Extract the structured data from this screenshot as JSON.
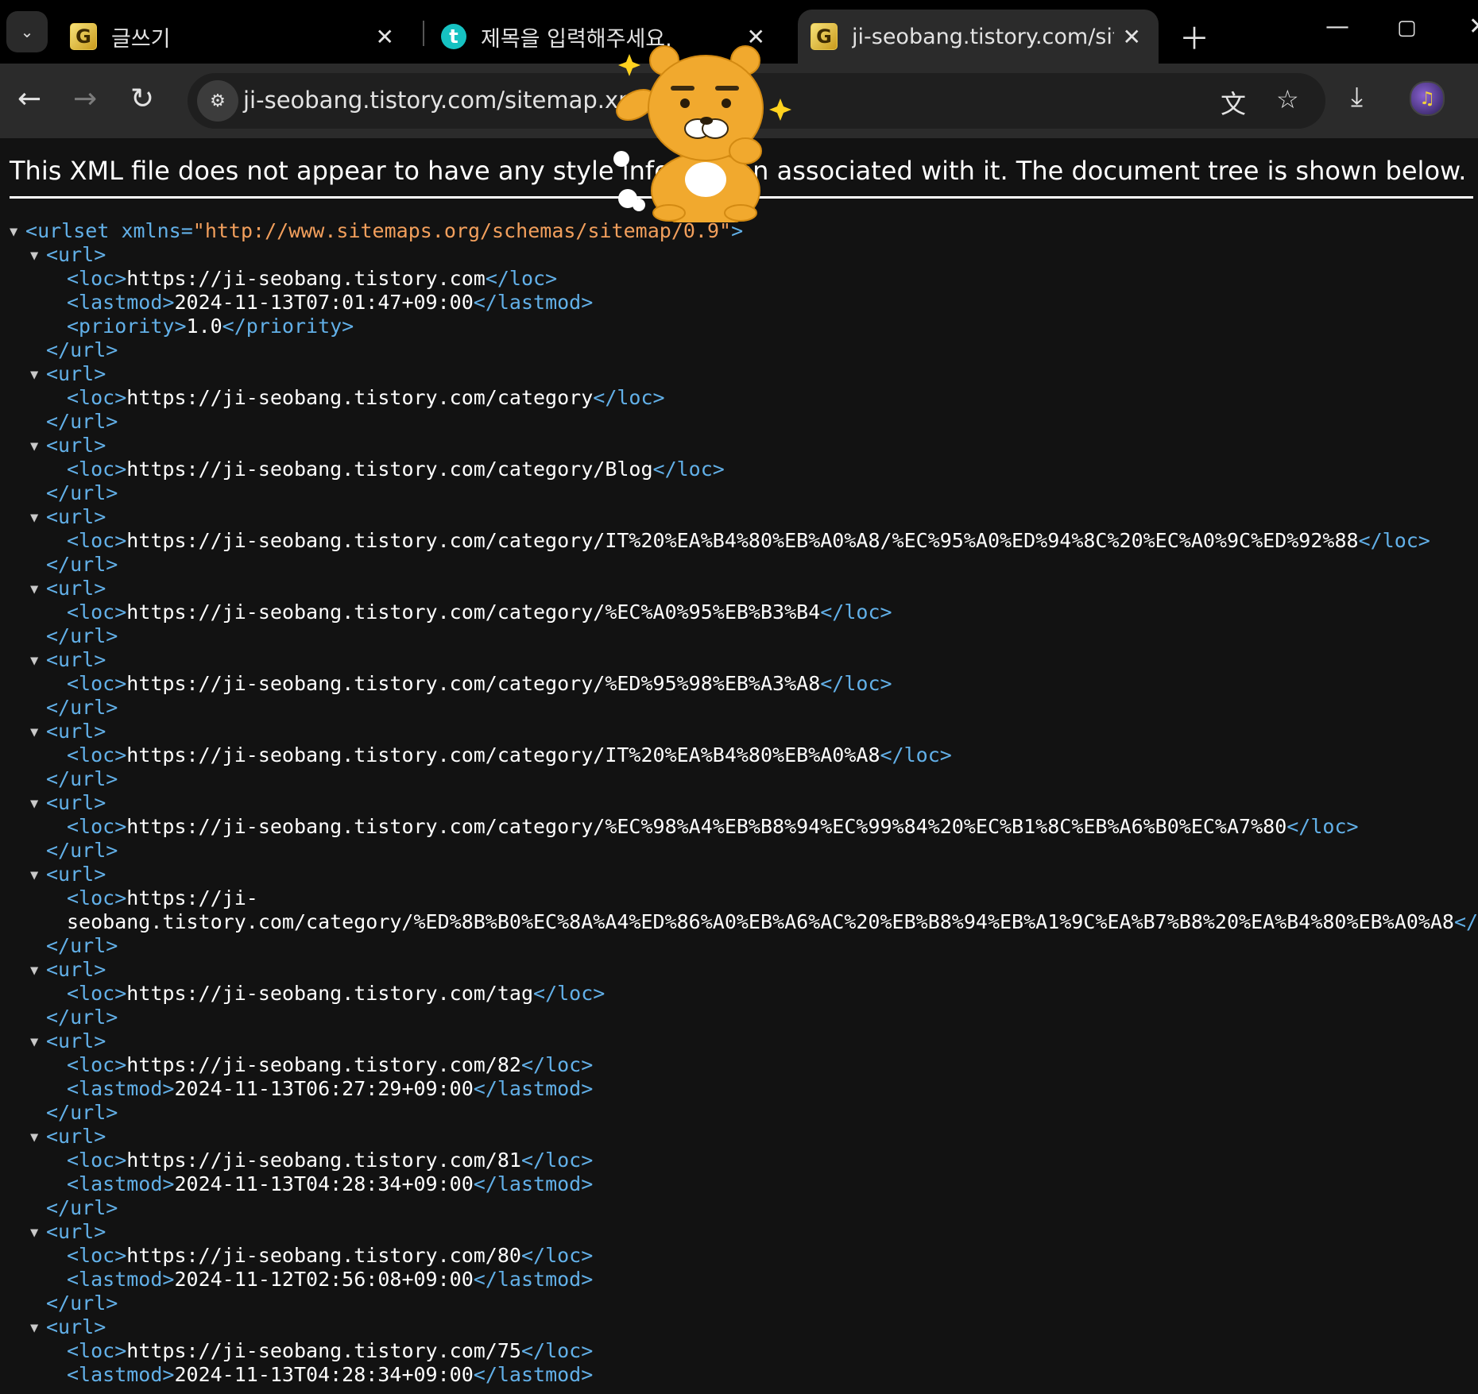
{
  "browser": {
    "tabs": [
      {
        "title": "글쓰기",
        "icon": "g-logo-icon"
      },
      {
        "title": "제목을 입력해주세요.",
        "icon": "tistory-logo-icon"
      },
      {
        "title": "ji-seobang.tistory.com/sitemap.xml",
        "icon": "g-logo-icon",
        "active": true
      }
    ],
    "omnibox": {
      "url": "ji-seobang.tistory.com/sitemap.xml"
    }
  },
  "page": {
    "info_message": "This XML file does not appear to have any style information associated with it. The document tree is shown below.",
    "root": {
      "tag": "urlset",
      "attr_name": "xmlns",
      "attr_value": "http://www.sitemaps.org/schemas/sitemap/0.9"
    },
    "urls": [
      {
        "loc": "https://ji-seobang.tistory.com",
        "lastmod": "2024-11-13T07:01:47+09:00",
        "priority": "1.0"
      },
      {
        "loc": "https://ji-seobang.tistory.com/category"
      },
      {
        "loc": "https://ji-seobang.tistory.com/category/Blog"
      },
      {
        "loc": "https://ji-seobang.tistory.com/category/IT%20%EA%B4%80%EB%A0%A8/%EC%95%A0%ED%94%8C%20%EC%A0%9C%ED%92%88"
      },
      {
        "loc": "https://ji-seobang.tistory.com/category/%EC%A0%95%EB%B3%B4"
      },
      {
        "loc": "https://ji-seobang.tistory.com/category/%ED%95%98%EB%A3%A8"
      },
      {
        "loc": "https://ji-seobang.tistory.com/category/IT%20%EA%B4%80%EB%A0%A8"
      },
      {
        "loc": "https://ji-seobang.tistory.com/category/%EC%98%A4%EB%B8%94%EC%99%84%20%EC%B1%8C%EB%A6%B0%EC%A7%80"
      },
      {
        "loc_part1": "https://ji-",
        "loc_part2": "seobang.tistory.com/category/%ED%8B%B0%EC%8A%A4%ED%86%A0%EB%A6%AC%20%EB%B8%94%EB%A1%9C%EA%B7%B8%20%EA%B4%80%EB%A0%A8"
      },
      {
        "loc": "https://ji-seobang.tistory.com/tag"
      },
      {
        "loc": "https://ji-seobang.tistory.com/82",
        "lastmod": "2024-11-13T06:27:29+09:00"
      },
      {
        "loc": "https://ji-seobang.tistory.com/81",
        "lastmod": "2024-11-13T04:28:34+09:00"
      },
      {
        "loc": "https://ji-seobang.tistory.com/80",
        "lastmod": "2024-11-12T02:56:08+09:00"
      },
      {
        "loc": "https://ji-seobang.tistory.com/75",
        "lastmod": "2024-11-13T04:28:34+09:00"
      }
    ]
  }
}
